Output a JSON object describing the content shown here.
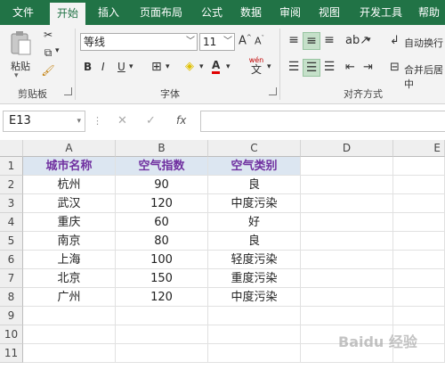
{
  "ribbon": {
    "tabs": [
      "文件",
      "开始",
      "插入",
      "页面布局",
      "公式",
      "数据",
      "审阅",
      "视图",
      "开发工具",
      "帮助"
    ],
    "active_tab": "开始",
    "clipboard": {
      "paste_label": "粘贴",
      "group_label": "剪贴板"
    },
    "font": {
      "name": "等线",
      "size": "11",
      "group_label": "字体",
      "wen_label": "wén",
      "wen_char": "文"
    },
    "alignment": {
      "wrap_label": "自动换行",
      "merge_label": "合并后居中",
      "group_label": "对齐方式"
    }
  },
  "formula_bar": {
    "name_box": "E13",
    "fx": "fx",
    "formula": ""
  },
  "grid": {
    "col_headers": [
      "A",
      "B",
      "C",
      "D",
      "E"
    ],
    "row_headers": [
      "1",
      "2",
      "3",
      "4",
      "5",
      "6",
      "7",
      "8",
      "9",
      "10",
      "11"
    ],
    "header_row": [
      "城市名称",
      "空气指数",
      "空气类别"
    ],
    "rows": [
      [
        "杭州",
        "90",
        "良"
      ],
      [
        "武汉",
        "120",
        "中度污染"
      ],
      [
        "重庆",
        "60",
        "好"
      ],
      [
        "南京",
        "80",
        "良"
      ],
      [
        "上海",
        "100",
        "轻度污染"
      ],
      [
        "北京",
        "150",
        "重度污染"
      ],
      [
        "广州",
        "120",
        "中度污染"
      ]
    ]
  },
  "watermark": "Baidu 经验",
  "colors": {
    "brand": "#217346",
    "header_fill": "#dce6f1",
    "header_text": "#7030a0"
  }
}
